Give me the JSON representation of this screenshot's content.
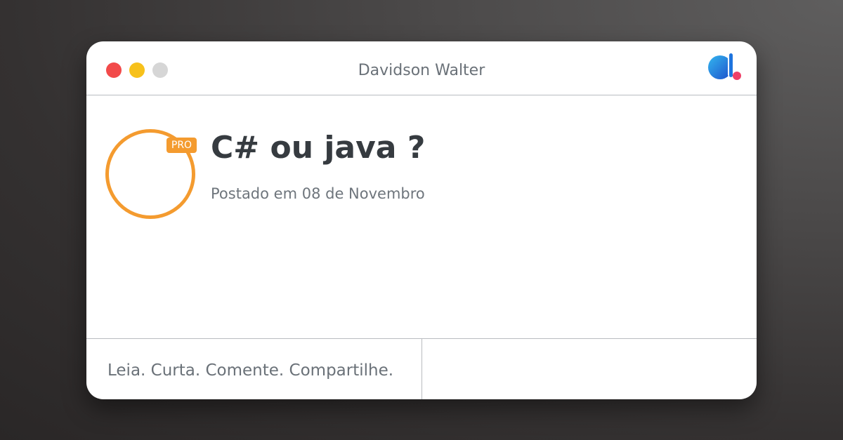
{
  "window": {
    "title": "Davidson Walter",
    "controls": [
      "close-dot",
      "minimize-dot",
      "maximize-dot"
    ],
    "logo_icon": "brand-logo-icon"
  },
  "post": {
    "badge": "PRO",
    "title": "C# ou java ?",
    "date": "Postado em 08 de Novembro"
  },
  "footer": {
    "tagline": "Leia. Curta. Comente. Compartilhe."
  },
  "colors": {
    "accent_orange": "#f49b2f",
    "close_red": "#f24a4a",
    "minimize_yellow": "#f7c11b",
    "maximize_gray": "#d6d6d6",
    "logo_blue": "#1f8fe3",
    "logo_pink": "#ee3f67"
  }
}
